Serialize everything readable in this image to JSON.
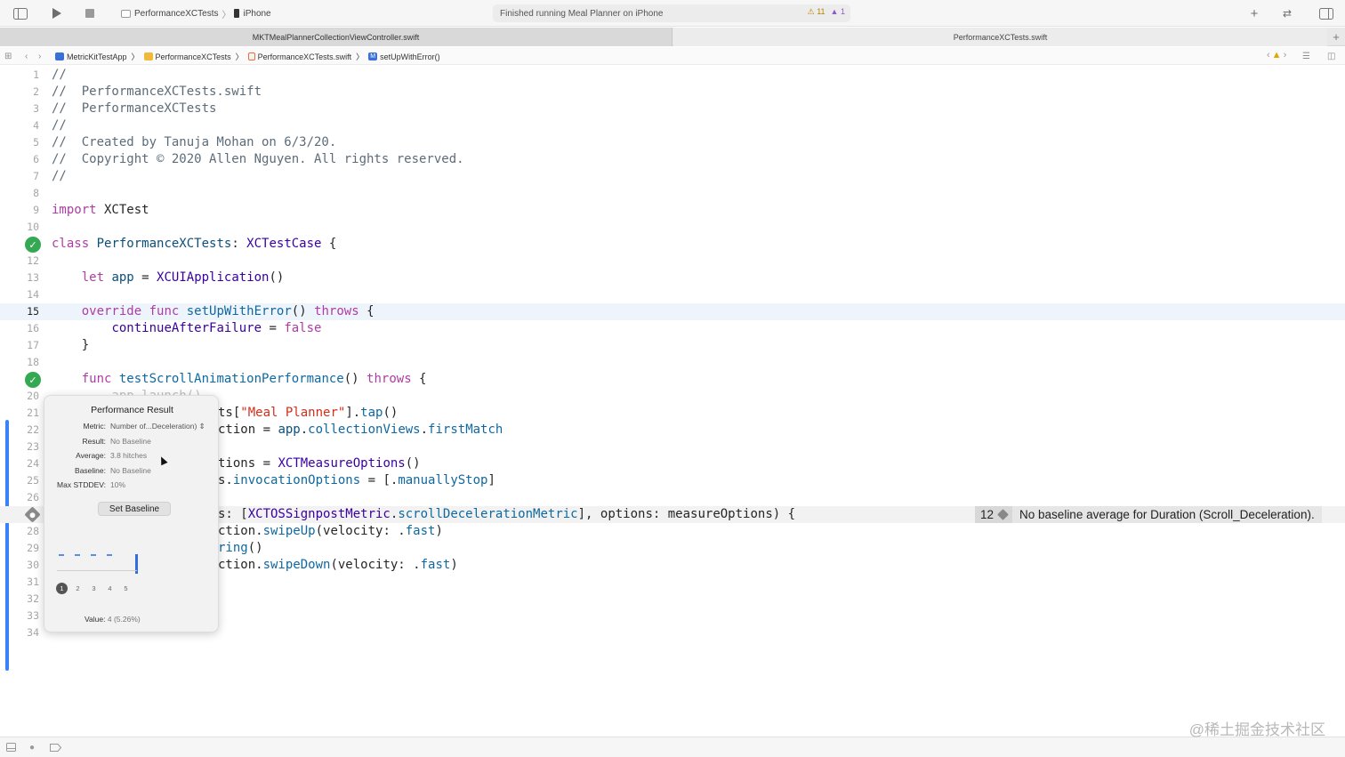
{
  "toolbar": {
    "scheme_target": "PerformanceXCTests",
    "scheme_device": "iPhone",
    "activity_status": "Finished running Meal Planner on iPhone",
    "warning_count": "11",
    "issue_count": "1",
    "icons": [
      "sidebar-toggle-icon",
      "play-icon",
      "stop-icon",
      "plus-icon",
      "review-icon",
      "inspector-icon"
    ]
  },
  "tabs": [
    {
      "label": "MKTMealPlannerCollectionViewController.swift",
      "active": true
    },
    {
      "label": "PerformanceXCTests.swift",
      "active": false
    }
  ],
  "jumpbar": {
    "crumbs": [
      "MetricKitTestApp",
      "PerformanceXCTests",
      "PerformanceXCTests.swift",
      "setUpWithError()"
    ]
  },
  "editor": {
    "current_line": 15,
    "lines": [
      {
        "n": "1",
        "text": "//"
      },
      {
        "n": "2",
        "text": "//  PerformanceXCTests.swift"
      },
      {
        "n": "3",
        "text": "//  PerformanceXCTests"
      },
      {
        "n": "4",
        "text": "//"
      },
      {
        "n": "5",
        "text": "//  Created by Tanuja Mohan on 6/3/20."
      },
      {
        "n": "6",
        "text": "//  Copyright © 2020 Allen Nguyen. All rights reserved."
      },
      {
        "n": "7",
        "text": "//"
      },
      {
        "n": "8",
        "text": ""
      },
      {
        "n": "9",
        "text": "import XCTest"
      },
      {
        "n": "10",
        "text": ""
      },
      {
        "n": "11",
        "text": "class PerformanceXCTests: XCTestCase {"
      },
      {
        "n": "12",
        "text": ""
      },
      {
        "n": "13",
        "text": "    let app = XCUIApplication()"
      },
      {
        "n": "14",
        "text": ""
      },
      {
        "n": "15",
        "text": "    override func setUpWithError() throws {"
      },
      {
        "n": "16",
        "text": "        continueAfterFailure = false"
      },
      {
        "n": "17",
        "text": "    }"
      },
      {
        "n": "18",
        "text": ""
      },
      {
        "n": "19",
        "text": "    func testScrollAnimationPerformance() throws {"
      },
      {
        "n": "20",
        "text": "        app.launch()"
      },
      {
        "n": "21",
        "text": "ts[\"Meal Planner\"].tap()"
      },
      {
        "n": "22",
        "text": "ction = app.collectionViews.firstMatch"
      },
      {
        "n": "23",
        "text": ""
      },
      {
        "n": "24",
        "text": "tions = XCTMeasureOptions()"
      },
      {
        "n": "25",
        "text": "s.invocationOptions = [.manuallyStop]"
      },
      {
        "n": "26",
        "text": ""
      },
      {
        "n": "27",
        "text": "s: [XCTOSSignpostMetric.scrollDecelerationMetric], options: measureOptions) {"
      },
      {
        "n": "28",
        "text": "ction.swipeUp(velocity: .fast)"
      },
      {
        "n": "29",
        "text": "ring()"
      },
      {
        "n": "30",
        "text": "ction.swipeDown(velocity: .fast)"
      },
      {
        "n": "31",
        "text": ""
      },
      {
        "n": "32",
        "text": ""
      },
      {
        "n": "33",
        "text": ""
      },
      {
        "n": "34",
        "text": ""
      }
    ]
  },
  "annotation": {
    "count": "12",
    "message": "No baseline average for Duration (Scroll_Deceleration)."
  },
  "popover": {
    "title": "Performance Result",
    "rows": [
      {
        "label": "Metric:",
        "value": "Number of...Deceleration) ⇕"
      },
      {
        "label": "Result:",
        "value": "No Baseline"
      },
      {
        "label": "Average:",
        "value": "3.8 hitches"
      },
      {
        "label": "Baseline:",
        "value": "No Baseline"
      },
      {
        "label": "Max STDDEV:",
        "value": "10%"
      }
    ],
    "set_baseline_label": "Set Baseline",
    "runs": [
      "1",
      "2",
      "3",
      "4",
      "5"
    ],
    "selected_run": "1",
    "value_label": "Value:",
    "value_text": "4 (5.26%)"
  },
  "watermark": "@稀土掘金技术社区",
  "colors": {
    "keyword": "#ad3da4",
    "comment": "#5d6c79",
    "type": "#3900a0",
    "function": "#0f68a0",
    "string": "#d12f1b",
    "test_pass": "#34a853",
    "change_bar": "#3a82f7"
  }
}
